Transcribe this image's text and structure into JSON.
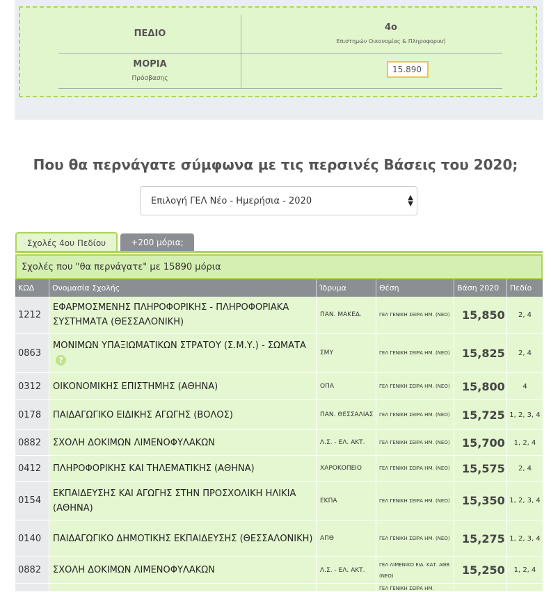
{
  "summary": {
    "field_label": "ΠΕΔΙΟ",
    "field_value": "4ο",
    "field_desc": "Επιστημών Οικονομίας & Πληροφορική",
    "moria_label": "ΜΟΡΙΑ",
    "moria_sub": "Πρόσβασης",
    "moria_value": "15.890"
  },
  "question": "Που θα περνάγατε σύμφωνα με τις περσινές Βάσεις του 2020;",
  "select": {
    "selected": "Επιλογή ΓΕΛ Νέο - Ημερήσια - 2020"
  },
  "tabs": [
    {
      "label": "Σχολές 4ου Πεδίου"
    },
    {
      "label": "+200 μόρια;"
    }
  ],
  "table": {
    "caption": "Σχολές που \"θα περνάγατε\" με 15890 μόρια",
    "headers": [
      "ΚΩΔ",
      "Ονομασία Σχολής",
      "Ίδρυμα",
      "Θέση",
      "Βάση 2020",
      "Πεδίο"
    ],
    "rows": [
      {
        "code": "1212",
        "name": "ΕΦΑΡΜΟΣΜΕΝΗΣ ΠΛΗΡΟΦΟΡΙΚΗΣ - ΠΛΗΡΟΦΟΡΙΑΚΑ ΣΥΣΤΗΜΑΤΑ (ΘΕΣΣΑΛΟΝΙΚΗ)",
        "inst": "ΠΑΝ. ΜΑΚΕΔ.",
        "pos": "ΓΕΛ ΓΕΝΙΚΗ ΣΕΙΡΑ ΗΜ. (ΝΕΟ)",
        "base": "15,850",
        "field": "2, 4"
      },
      {
        "code": "0863",
        "name": "ΜΟΝΙΜΩΝ ΥΠΑΞΙΩΜΑΤΙΚΩΝ ΣΤΡΑΤΟΥ (Σ.Μ.Υ.) - ΣΩΜΑΤΑ",
        "inst": "ΣΜΥ",
        "pos": "ΓΕΛ ΓΕΝΙΚΗ ΣΕΙΡΑ ΗΜ. (ΝΕΟ)",
        "base": "15,825",
        "field": "2, 4",
        "help": "?"
      },
      {
        "code": "0312",
        "name": "ΟΙΚΟΝΟΜΙΚΗΣ ΕΠΙΣΤΗΜΗΣ (ΑΘΗΝΑ)",
        "inst": "ΟΠΑ",
        "pos": "ΓΕΛ ΓΕΝΙΚΗ ΣΕΙΡΑ ΗΜ. (ΝΕΟ)",
        "base": "15,800",
        "field": "4"
      },
      {
        "code": "0178",
        "name": "ΠΑΙΔΑΓΩΓΙΚΟ ΕΙΔΙΚΗΣ ΑΓΩΓΗΣ (ΒΟΛΟΣ)",
        "inst": "ΠΑΝ. ΘΕΣΣΑΛΙΑΣ",
        "pos": "ΓΕΛ ΓΕΝΙΚΗ ΣΕΙΡΑ ΗΜ. (ΝΕΟ)",
        "base": "15,725",
        "field": "1, 2, 3, 4"
      },
      {
        "code": "0882",
        "name": "ΣΧΟΛΗ ΔΟΚΙΜΩΝ ΛΙΜΕΝΟΦΥΛΑΚΩΝ",
        "inst": "Λ.Σ. - ΕΛ. ΑΚΤ.",
        "pos": "ΓΕΛ ΓΕΝΙΚΗ ΣΕΙΡΑ ΗΜ. (ΝΕΟ)",
        "base": "15,700",
        "field": "1, 2, 4"
      },
      {
        "code": "0412",
        "name": "ΠΛΗΡΟΦΟΡΙΚΗΣ ΚΑΙ ΤΗΛΕΜΑΤΙΚΗΣ (ΑΘΗΝΑ)",
        "inst": "ΧΑΡΟΚΟΠΕΙΟ",
        "pos": "ΓΕΛ ΓΕΝΙΚΗ ΣΕΙΡΑ ΗΜ. (ΝΕΟ)",
        "base": "15,575",
        "field": "2, 4"
      },
      {
        "code": "0154",
        "name": "ΕΚΠΑΙΔΕΥΣΗΣ ΚΑΙ ΑΓΩΓΗΣ ΣΤΗΝ ΠΡΟΣΧΟΛΙΚΗ ΗΛΙΚΙΑ (ΑΘΗΝΑ)",
        "inst": "ΕΚΠΑ",
        "pos": "ΓΕΛ ΓΕΝΙΚΗ ΣΕΙΡΑ ΗΜ. (ΝΕΟ)",
        "base": "15,350",
        "field": "1, 2, 3, 4"
      },
      {
        "code": "0140",
        "name": "ΠΑΙΔΑΓΩΓΙΚΟ ΔΗΜΟΤΙΚΗΣ ΕΚΠΑΙΔΕΥΣΗΣ (ΘΕΣΣΑΛΟΝΙΚΗ)",
        "inst": "ΑΠΘ",
        "pos": "ΓΕΛ ΓΕΝΙΚΗ ΣΕΙΡΑ ΗΜ. (ΝΕΟ)",
        "base": "15,275",
        "field": "1, 2, 3, 4"
      },
      {
        "code": "0882",
        "name": "ΣΧΟΛΗ ΔΟΚΙΜΩΝ ΛΙΜΕΝΟΦΥΛΑΚΩΝ",
        "inst": "Λ.Σ. - ΕΛ. ΑΚΤ.",
        "pos": "ΓΕΛ ΛΙΜΕΝΙΚΟ ΕΙΔ. ΚΑΤ. ΑΘΒ (ΝΕΟ)",
        "base": "15,250",
        "field": "1, 2, 4"
      },
      {
        "code": "",
        "name": "",
        "inst": "",
        "pos": "ΓΕΛ ΓΕΝΙΚΗ ΣΕΙΡΑ ΗΜ.",
        "base": "",
        "field": ""
      }
    ]
  }
}
